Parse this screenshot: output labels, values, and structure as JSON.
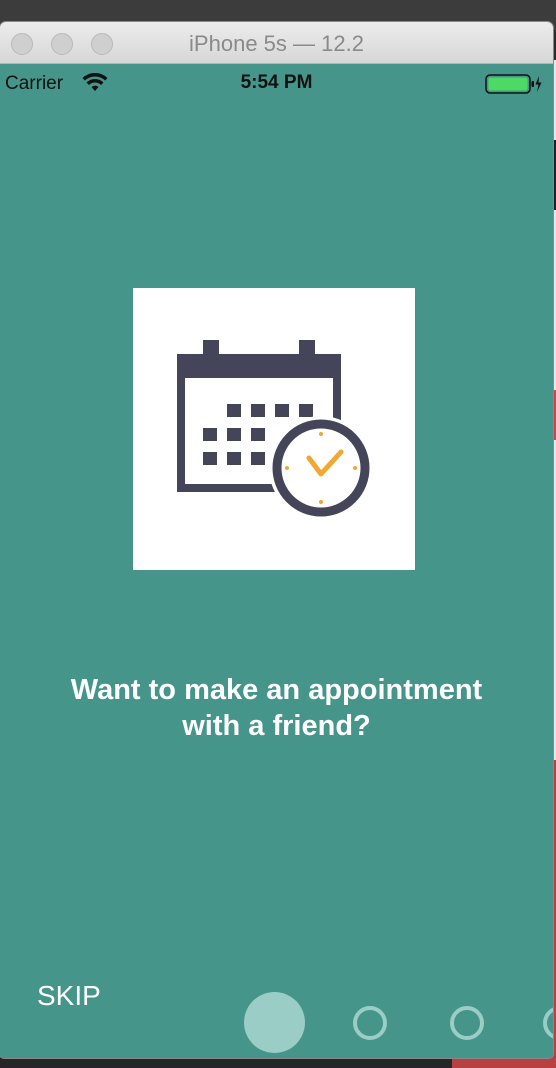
{
  "window": {
    "title": "iPhone 5s — 12.2"
  },
  "status_bar": {
    "carrier": "Carrier",
    "time": "5:54 PM",
    "battery_color": "#4cd964"
  },
  "onboarding": {
    "illustration_icon": "calendar-clock-icon",
    "headline_line1": "Want to make an appointment",
    "headline_line2": "with a friend?",
    "skip_label": "SKIP",
    "page_indicator": {
      "total_visible": 4,
      "current_page": 1
    }
  },
  "colors": {
    "background": "#45958a",
    "indicator": "#99cdc6",
    "icon_dark": "#45455a",
    "clock_accent": "#f0a830"
  }
}
